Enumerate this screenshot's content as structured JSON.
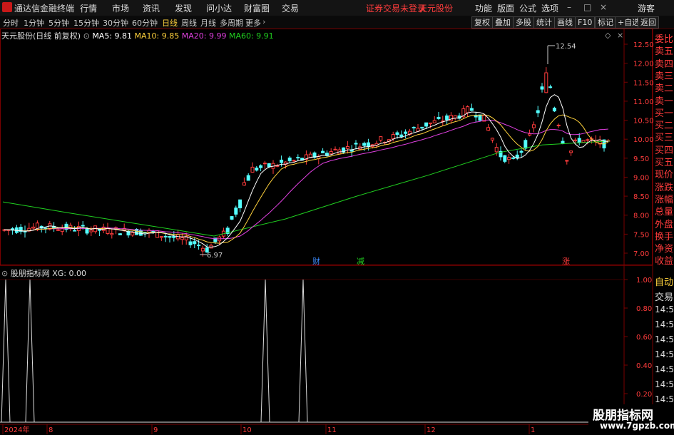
{
  "app": {
    "title": "通达信金融终端",
    "menu": [
      "行情",
      "市场",
      "资讯",
      "发现",
      "问小达",
      "财富圈",
      "交易"
    ],
    "notice": "证券交易未登录",
    "stock_name": "天元股份",
    "right_menu": [
      "功能",
      "版面",
      "公式",
      "选项"
    ],
    "guest": "游客"
  },
  "toolbar": {
    "periods": [
      "分时",
      "1分钟",
      "5分钟",
      "15分钟",
      "30分钟",
      "60分钟",
      "日线",
      "周线",
      "月线",
      "多周期",
      "更多"
    ],
    "active_period": "日线",
    "right_buttons": [
      "复权",
      "叠加",
      "多股",
      "统计",
      "画线",
      "F10",
      "标记",
      "+自选",
      "返回"
    ]
  },
  "main_chart": {
    "title": "天元股份(日线 前复权)",
    "ma": [
      {
        "label": "MA5: 9.81",
        "color": "#ffffff"
      },
      {
        "label": "MA10: 9.85",
        "color": "#ffd23c"
      },
      {
        "label": "MA20: 9.99",
        "color": "#e040e0"
      },
      {
        "label": "MA60: 9.91",
        "color": "#20d020"
      }
    ],
    "y_ticks": [
      "12.50",
      "12.00",
      "11.50",
      "11.00",
      "10.50",
      "10.00",
      "9.50",
      "9.00",
      "8.50",
      "8.00",
      "7.50",
      "7.00"
    ],
    "high_label": "12.54",
    "low_label": "6.97",
    "markers": [
      {
        "text": "财",
        "color": "#3c8cff"
      },
      {
        "text": "减",
        "color": "#20d020"
      },
      {
        "text": "涨",
        "color": "#ff3c3c"
      }
    ]
  },
  "sub_chart": {
    "title": "股朋指标网 XG: 0.00",
    "y_ticks": [
      "1.00",
      "0.80",
      "0.60",
      "0.40",
      "0.20"
    ]
  },
  "x_axis": [
    "2024年",
    "8",
    "9",
    "10",
    "11",
    "12",
    "1"
  ],
  "right_panel": {
    "quote_labels": [
      "委比",
      "卖五",
      "卖四",
      "卖三",
      "卖二",
      "卖一",
      "买一",
      "买二",
      "买三",
      "买四",
      "买五",
      "现价",
      "涨跌",
      "涨幅",
      "总量",
      "外盘",
      "换手",
      "净资",
      "收益"
    ],
    "lower_labels": [
      "自动",
      "交易",
      "14:56",
      "14:56",
      "14:56",
      "14:56",
      "14:56",
      "14:56",
      "14:56",
      "14:56"
    ]
  },
  "colors": {
    "up": "#ff3c3c",
    "down": "#54ffff",
    "background": "#000000"
  }
}
